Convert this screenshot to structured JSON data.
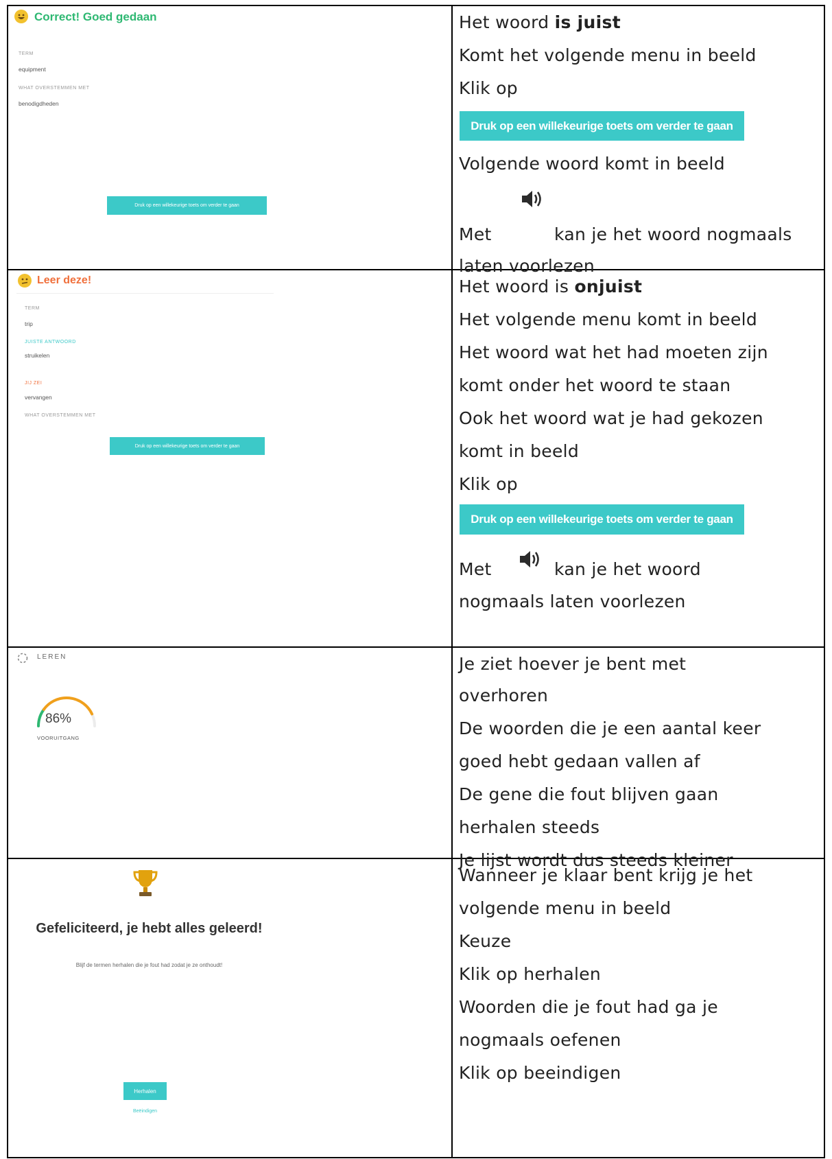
{
  "row1": {
    "header": "Correct! Goed gedaan",
    "term_label": "TERM",
    "term_value": "equipment",
    "def_label": "WHAT OVERSTEMMEN MET",
    "def_value": "benodigdheden",
    "continue_button": "Druk op een willekeurige toets om verder te gaan",
    "lines": {
      "l1a": "Het woord ",
      "l1b": "is juist",
      "l2": "Komt het volgende menu in beeld",
      "l3": "Klik op",
      "button": "Druk op een willekeurige toets om verder te gaan",
      "l4": "Volgende woord komt in beeld",
      "l5a": "Met",
      "l5b": "kan je het woord nogmaals",
      "l6": "laten voorlezen"
    }
  },
  "row2": {
    "header": "Leer deze!",
    "term_label": "TERM",
    "term_value": "trip",
    "correct_label": "JUISTE ANTWOORD",
    "correct_value": "struikelen",
    "yours_label": "JIJ ZEI",
    "yours_value": "vervangen",
    "def_label": "WHAT OVERSTEMMEN MET",
    "continue_button": "Druk op een willekeurige toets om verder te gaan",
    "lines": {
      "l1a": "Het woord is ",
      "l1b": "onjuist",
      "l2": "Het volgende menu komt in beeld",
      "l3": "Het woord wat het had moeten zijn",
      "l4": "komt onder het woord te staan",
      "l5": "Ook het woord wat je had gekozen",
      "l6": "komt in beeld",
      "l7": "Klik op",
      "button": "Druk op een willekeurige toets om verder te gaan",
      "l8a": "Met",
      "l8b": "kan je het woord",
      "l9": "nogmaals laten voorlezen"
    }
  },
  "row3": {
    "header": "LEREN",
    "progress_value": "86%",
    "progress_fraction": 0.86,
    "progress_label": "VOORUITGANG",
    "lines": {
      "l1": "Je ziet hoever je bent met",
      "l2": "overhoren",
      "l3": "De woorden die je een aantal keer",
      "l4": "goed hebt gedaan vallen af",
      "l5": "De gene die fout blijven gaan",
      "l6": "herhalen steeds",
      "l7": "Je lijst wordt dus steeds kleiner"
    }
  },
  "row4": {
    "title": "Gefeliciteerd, je hebt alles geleerd!",
    "subtitle": "Blijf de termen herhalen die je fout had zodat je ze onthoudt!",
    "repeat_button": "Herhalen",
    "finish_link": "Beëindigen",
    "lines": {
      "l1": "Wanneer je klaar bent krijg je het",
      "l2": "volgende menu in beeld",
      "l3": "Keuze",
      "l4": "Klik op herhalen",
      "l5": "Woorden die je fout had ga je",
      "l6": "nogmaals oefenen",
      "l7": "Klik op beeindigen"
    }
  },
  "colors": {
    "teal": "#3cc9c8",
    "green": "#2eb872",
    "orange": "#f0703c",
    "gold": "#e2a20e"
  },
  "icons": {
    "speaker": "speaker-icon",
    "trophy": "trophy-icon",
    "spinner": "spinner-icon"
  }
}
